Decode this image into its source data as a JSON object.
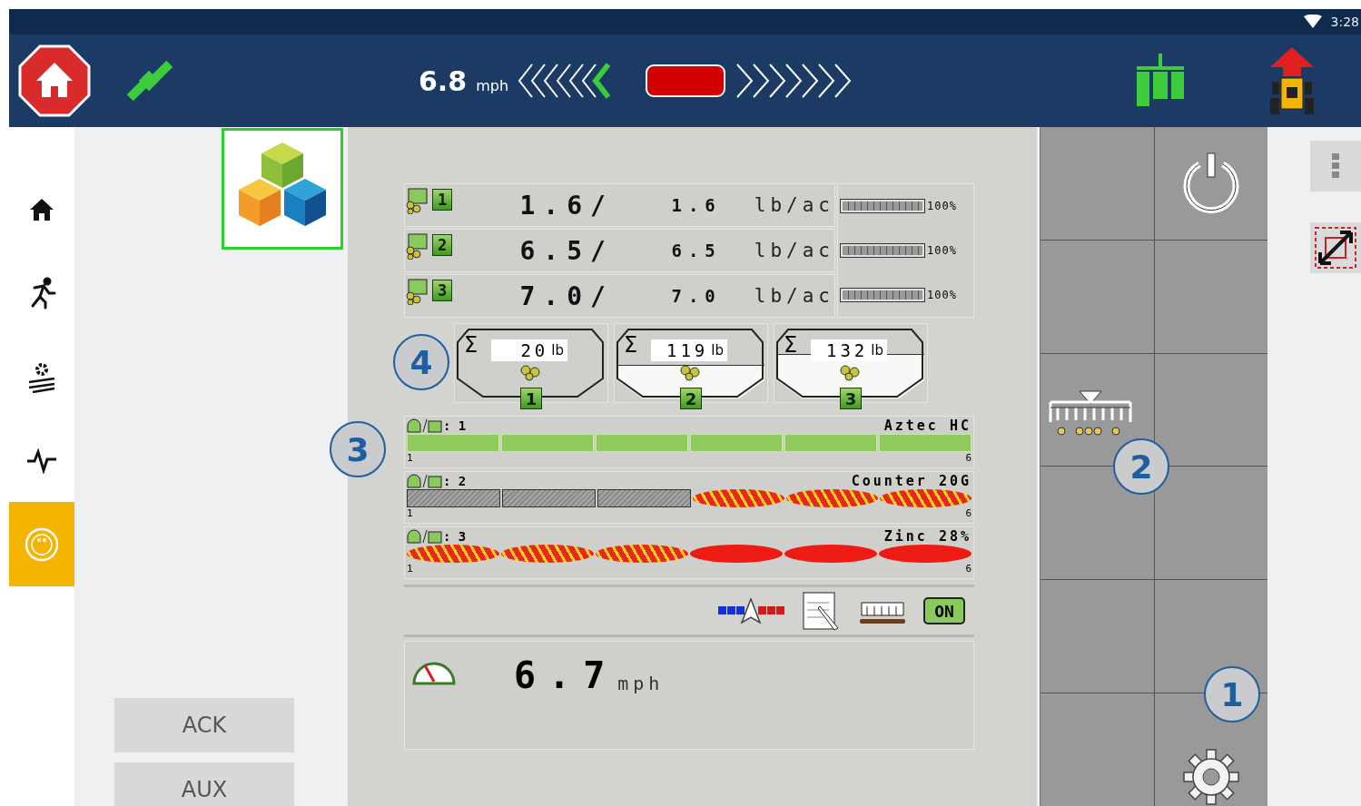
{
  "status_bar": {
    "time": "3:28"
  },
  "top_bar": {
    "speed": "6.8",
    "speed_unit": "mph"
  },
  "nav": [
    {
      "kind": "home",
      "selected": false
    },
    {
      "kind": "run",
      "selected": false
    },
    {
      "kind": "field",
      "selected": false
    },
    {
      "kind": "pulse",
      "selected": false
    },
    {
      "kind": "ut",
      "selected": true
    }
  ],
  "side_buttons": [
    {
      "label": "ACK"
    },
    {
      "label": "AUX"
    }
  ],
  "products": [
    {
      "badge": "1",
      "actual": "1.6/",
      "target": "1.6",
      "unit": "lb/ac",
      "level": 1,
      "percent": "100%"
    },
    {
      "badge": "2",
      "actual": "6.5/",
      "target": "6.5",
      "unit": "lb/ac",
      "level": 1,
      "percent": "100%"
    },
    {
      "badge": "3",
      "actual": "7.0/",
      "target": "7.0",
      "unit": "lb/ac",
      "level": 1,
      "percent": "100%"
    }
  ],
  "hoppers": [
    {
      "symbol": "Σ",
      "total": "20",
      "unit": "lb",
      "number": "1",
      "kind": "empty"
    },
    {
      "symbol": "Σ",
      "total": "119",
      "unit": "lb",
      "number": "2",
      "kind": "half"
    },
    {
      "symbol": "Σ",
      "total": "132",
      "unit": "lb",
      "number": "3",
      "kind": "high"
    }
  ],
  "sections": [
    {
      "label": ": 1",
      "product": "Aztec HC",
      "first": "1",
      "last": "6",
      "segments": [
        {
          "kind": "on"
        },
        {
          "kind": "on"
        },
        {
          "kind": "on"
        },
        {
          "kind": "on"
        },
        {
          "kind": "on"
        },
        {
          "kind": "on"
        }
      ]
    },
    {
      "label": ": 2",
      "product": "Counter 20G",
      "first": "1",
      "last": "6",
      "segments": [
        {
          "kind": "off"
        },
        {
          "kind": "off"
        },
        {
          "kind": "off"
        },
        {
          "kind": "striped"
        },
        {
          "kind": "striped"
        },
        {
          "kind": "striped"
        }
      ]
    },
    {
      "label": ": 3",
      "product": "Zinc 28%",
      "first": "1",
      "last": "6",
      "segments": [
        {
          "kind": "striped"
        },
        {
          "kind": "striped"
        },
        {
          "kind": "striped"
        },
        {
          "kind": "blocked"
        },
        {
          "kind": "blocked"
        },
        {
          "kind": "blocked"
        }
      ]
    }
  ],
  "tools": {
    "on_button": "ON"
  },
  "ground_speed": {
    "value": "6.7",
    "unit": "mph"
  },
  "softkeys": [
    {
      "kind": "empty"
    },
    {
      "kind": "power"
    },
    {
      "kind": "empty"
    },
    {
      "kind": "empty"
    },
    {
      "kind": "planter"
    },
    {
      "kind": "empty"
    },
    {
      "kind": "empty"
    },
    {
      "kind": "empty"
    },
    {
      "kind": "empty"
    },
    {
      "kind": "empty"
    },
    {
      "kind": "empty"
    },
    {
      "kind": "settings"
    }
  ],
  "callouts": [
    {
      "label": "4"
    },
    {
      "label": "3"
    },
    {
      "label": "2"
    },
    {
      "label": "1"
    }
  ]
}
